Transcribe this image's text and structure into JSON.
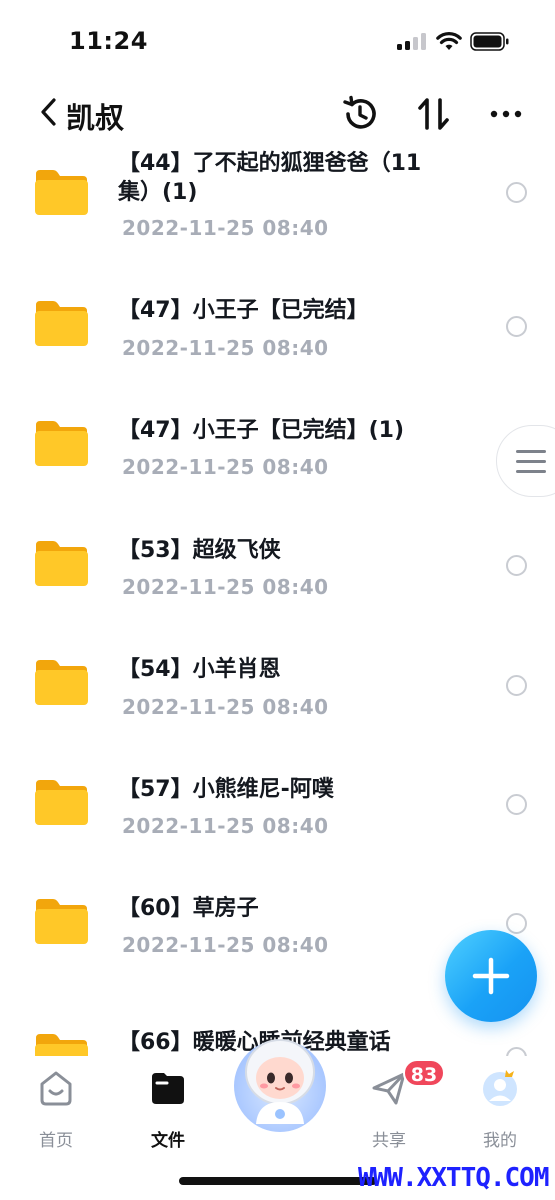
{
  "status_bar": {
    "time": "11:24"
  },
  "nav": {
    "title": "凯叔"
  },
  "files": [
    {
      "name": "【44】了不起的狐狸爸爸（11集）(1)",
      "date": "2022-11-25 08:40"
    },
    {
      "name": "【47】小王子【已完结】",
      "date": "2022-11-25 08:40"
    },
    {
      "name": "【47】小王子【已完结】(1)",
      "date": "2022-11-25 08:40"
    },
    {
      "name": "【53】超级飞侠",
      "date": "2022-11-25 08:40"
    },
    {
      "name": "【54】小羊肖恩",
      "date": "2022-11-25 08:40"
    },
    {
      "name": "【57】小熊维尼-阿噗",
      "date": "2022-11-25 08:40"
    },
    {
      "name": "【60】草房子",
      "date": "2022-11-25 08:40"
    },
    {
      "name": "【66】暖暖心睡前经典童话",
      "date": ""
    }
  ],
  "tabs": [
    {
      "label": "首页",
      "icon": "home-icon"
    },
    {
      "label": "文件",
      "icon": "folder-tab-icon"
    },
    {
      "label": "共享",
      "icon": "send-icon",
      "badge": "83"
    },
    {
      "label": "我的",
      "icon": "profile-icon"
    }
  ],
  "watermark": "WWW.XXTTQ.COM",
  "colors": {
    "accent": "#1aa2f7",
    "folder": "#ffc21a",
    "badge": "#f0475b",
    "muted": "#a8adb7"
  }
}
